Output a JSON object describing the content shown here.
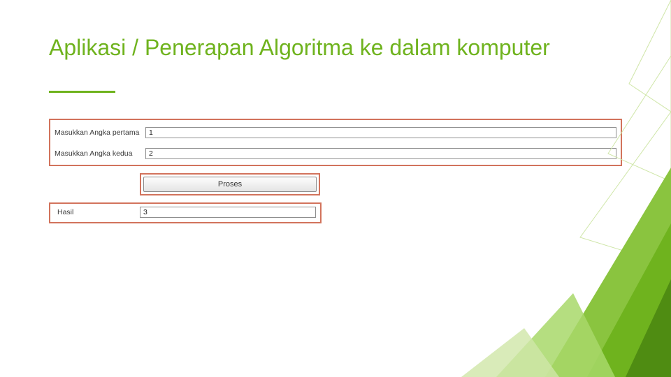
{
  "title": "Aplikasi / Penerapan Algoritma ke dalam komputer",
  "form": {
    "input1": {
      "label": "Masukkan Angka pertama",
      "value": "1"
    },
    "input2": {
      "label": "Masukkan Angka kedua",
      "value": "2"
    },
    "button_label": "Proses",
    "result": {
      "label": "Hasil",
      "value": "3"
    }
  },
  "colors": {
    "accent_green": "#6fb31e",
    "highlight_border": "#d2735c"
  }
}
